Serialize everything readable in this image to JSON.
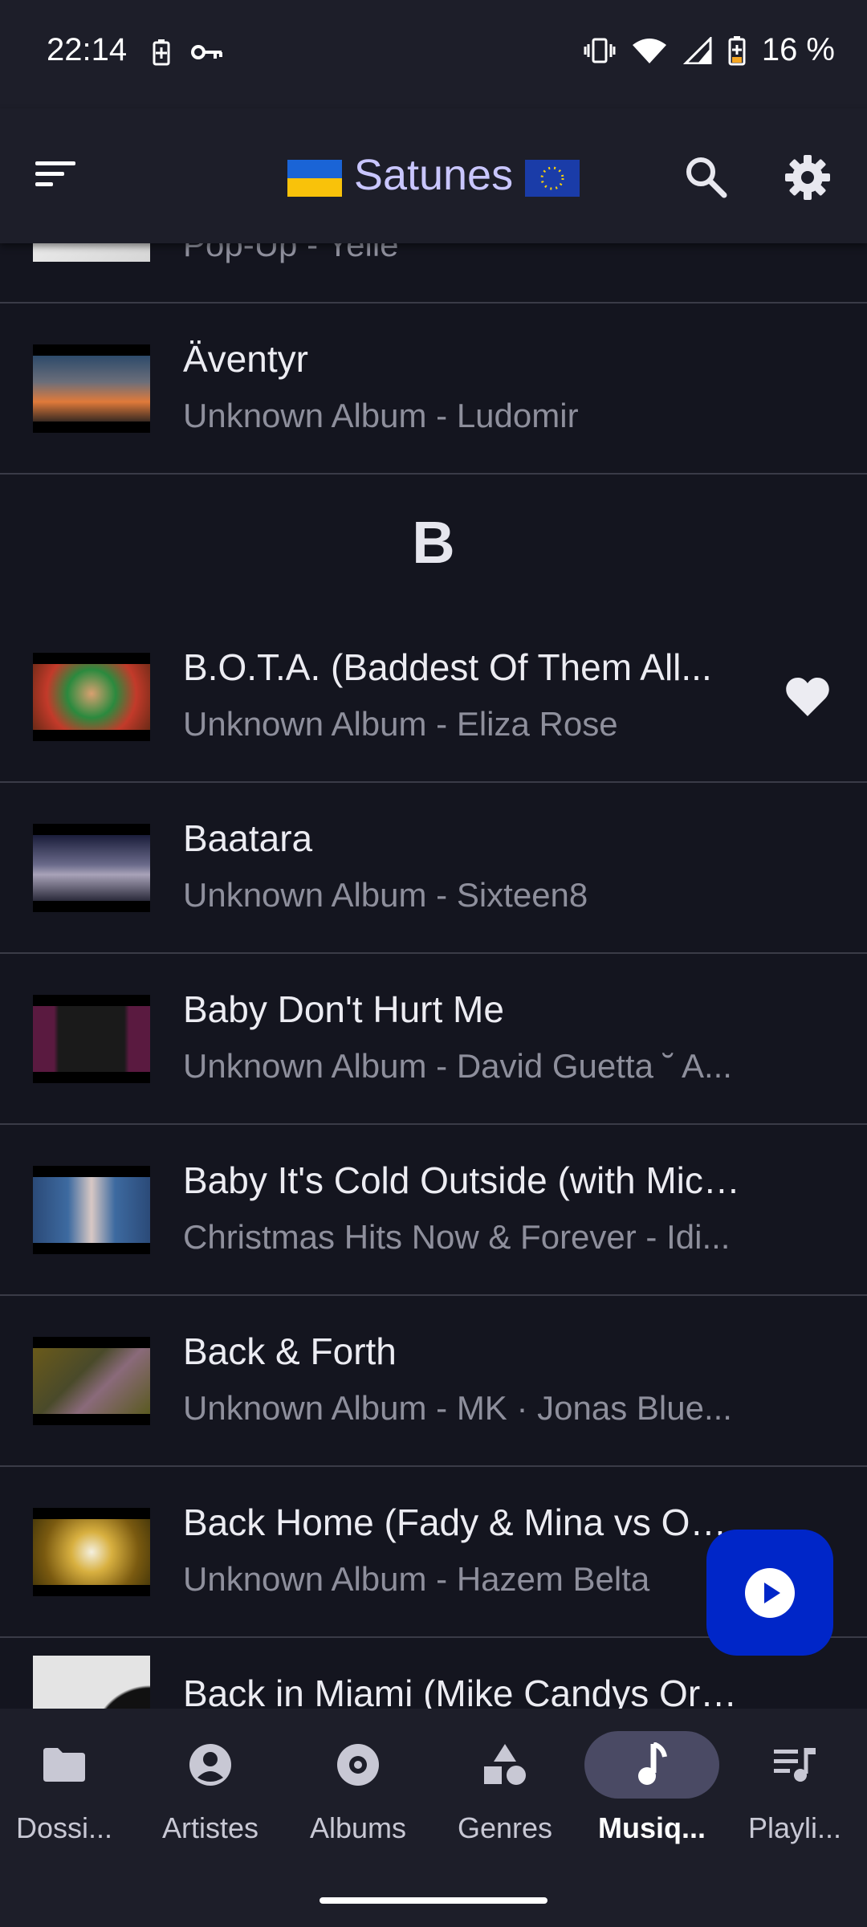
{
  "status_bar": {
    "time": "22:14",
    "battery": "16 %",
    "left_icons": [
      "battery-saver-icon",
      "vpn-key-icon"
    ],
    "right_icons": [
      "vibrate-icon",
      "wifi-icon",
      "cell-signal-icon",
      "battery-icon"
    ]
  },
  "app_bar": {
    "title": "Satunes",
    "title_prefix_flag": "ukraine-flag-icon",
    "title_suffix_flag": "eu-flag-icon",
    "actions": [
      "search-icon",
      "settings-icon"
    ]
  },
  "songs_before": [
    {
      "title": "",
      "subtitle": "Pop-Up - Yelle",
      "liked": false
    },
    {
      "title": "Äventyr",
      "subtitle": "Unknown Album - Ludomir",
      "liked": false
    }
  ],
  "section_letter": "B",
  "songs": [
    {
      "title": "B.O.T.A. (Baddest Of Them All...",
      "subtitle": "Unknown Album - Eliza Rose",
      "liked": true
    },
    {
      "title": "Baatara",
      "subtitle": "Unknown Album - Sixteen8",
      "liked": false
    },
    {
      "title": "Baby Don't Hurt Me",
      "subtitle": "Unknown Album - David Guetta ˘ A...",
      "liked": false
    },
    {
      "title": "Baby It's Cold Outside (with Mich...",
      "subtitle": "Christmas Hits Now & Forever - Idi...",
      "liked": false
    },
    {
      "title": "Back & Forth",
      "subtitle": "Unknown Album - MK · Jonas Blue...",
      "liked": false
    },
    {
      "title": "Back Home (Fady & Mina vs Om...",
      "subtitle": "Unknown Album - Hazem Belta",
      "liked": false
    },
    {
      "title": "Back in Miami (Mike Candys Orig...",
      "subtitle": "",
      "liked": false
    }
  ],
  "fab": {
    "icon": "play-icon"
  },
  "bottom_nav": [
    {
      "label": "Dossi...",
      "icon": "folder-icon",
      "active": false
    },
    {
      "label": "Artistes",
      "icon": "artist-icon",
      "active": false
    },
    {
      "label": "Albums",
      "icon": "album-icon",
      "active": false
    },
    {
      "label": "Genres",
      "icon": "genres-icon",
      "active": false
    },
    {
      "label": "Musiq...",
      "icon": "music-note-icon",
      "active": true
    },
    {
      "label": "Playli...",
      "icon": "playlist-icon",
      "active": false
    }
  ],
  "colors": {
    "background": "#14151f",
    "bar": "#1d1e29",
    "title_accent": "#c9c6ff",
    "fab": "#0026c8",
    "active_pill": "#4a4a64"
  }
}
